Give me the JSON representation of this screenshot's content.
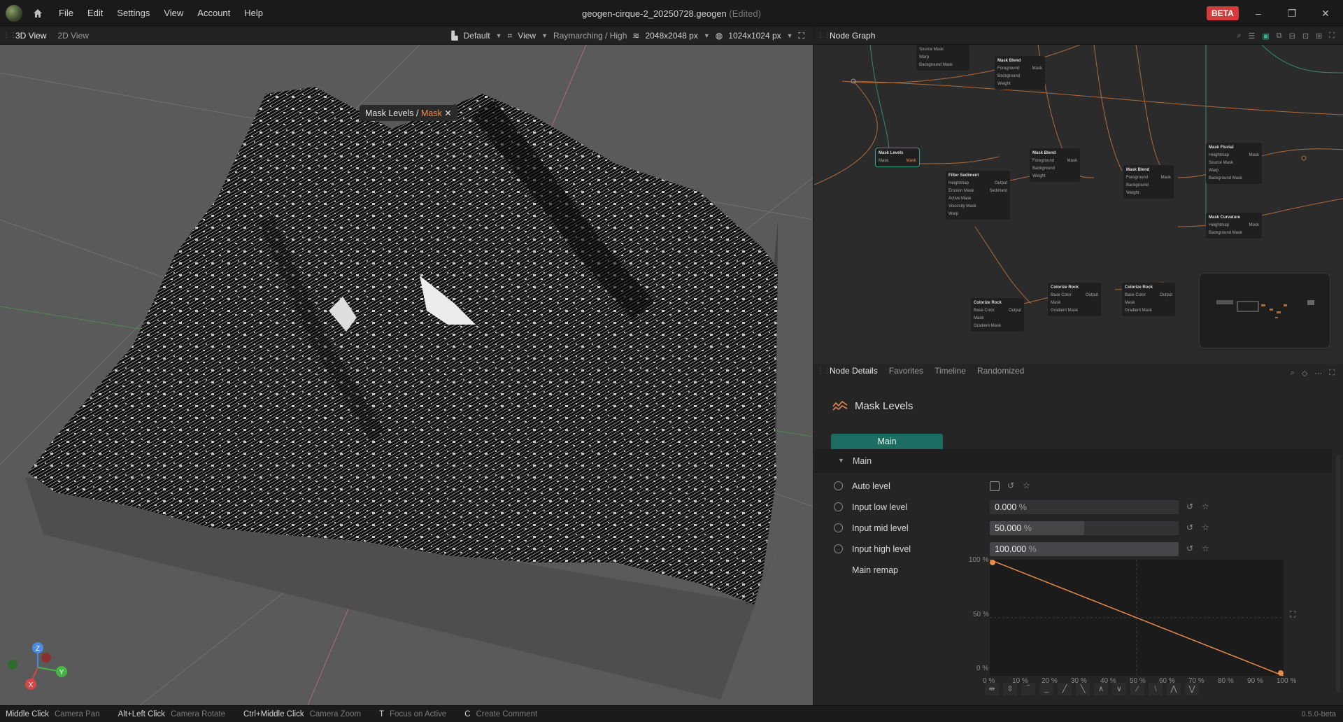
{
  "window": {
    "title": "geogen-cirque-2_20250728.geogen",
    "edited": "(Edited)",
    "badge": "BETA"
  },
  "menu": [
    "File",
    "Edit",
    "Settings",
    "View",
    "Account",
    "Help"
  ],
  "viewport_toolbar": {
    "tabs": [
      "3D View",
      "2D View"
    ],
    "preset": "Default",
    "view": "View",
    "render_mode": "Raymarching / High",
    "resolution": "2048x2048 px",
    "preview_resolution": "1024x1024 px"
  },
  "viewport": {
    "breadcrumb_node": "Mask Levels",
    "breadcrumb_sep": "/",
    "breadcrumb_port": "Mask",
    "gizmo": {
      "x": "X",
      "y": "Y",
      "z": "Z"
    }
  },
  "node_graph": {
    "title": "Node Graph",
    "nodes": [
      {
        "title": "",
        "ports": [
          "Source Mask",
          "Warp",
          "Background Mask"
        ]
      },
      {
        "title": "Mask Blend",
        "ports": [
          "Foreground",
          "Background",
          "Weight"
        ],
        "out": "Mask"
      },
      {
        "title": "Mask Levels",
        "ports": [
          "Mask"
        ],
        "out": "Mask"
      },
      {
        "title": "Filter Sediment",
        "ports": [
          "Heightmap",
          "Erosion Mask",
          "Active Mask",
          "Viscosity Mask",
          "Warp"
        ],
        "out": "Output",
        "out2": "Sediment"
      },
      {
        "title": "Mask Blend",
        "ports": [
          "Foreground",
          "Background",
          "Weight"
        ],
        "out": "Mask"
      },
      {
        "title": "Mask Blend",
        "ports": [
          "Foreground",
          "Background",
          "Weight"
        ],
        "out": "Mask"
      },
      {
        "title": "Mask Fluvial",
        "ports": [
          "Heightmap",
          "Source Mask",
          "Warp",
          "Background Mask"
        ],
        "out": "Mask"
      },
      {
        "title": "Mask Curvature",
        "ports": [
          "Heightmap",
          "Background Mask"
        ],
        "out": "Mask"
      },
      {
        "title": "Colorize Rock",
        "ports": [
          "Base Color",
          "Mask",
          "Gradient Mask"
        ],
        "out": "Output"
      },
      {
        "title": "Colorize Rock",
        "ports": [
          "Base Color",
          "Mask",
          "Gradient Mask"
        ],
        "out": "Output"
      },
      {
        "title": "Colorize Rock",
        "ports": [
          "Base Color",
          "Mask",
          "Gradient Mask"
        ],
        "out": "Output"
      }
    ]
  },
  "details": {
    "tabs": [
      "Node Details",
      "Favorites",
      "Timeline",
      "Randomized"
    ],
    "node_title": "Mask Levels",
    "section_tab": "Main",
    "section": "Main",
    "params": {
      "auto_level": {
        "label": "Auto level",
        "checked": false
      },
      "input_low": {
        "label": "Input low level",
        "value": "0.000",
        "unit": "%",
        "fraction": 0.0
      },
      "input_mid": {
        "label": "Input mid level",
        "value": "50.000",
        "unit": "%",
        "fraction": 0.5
      },
      "input_high": {
        "label": "Input high level",
        "value": "100.000",
        "unit": "%",
        "fraction": 1.0
      }
    },
    "remap": {
      "label": "Main remap",
      "y_ticks": [
        "100 %",
        "50 %",
        "0 %"
      ],
      "x_ticks": [
        "0 %",
        "10 %",
        "20 %",
        "30 %",
        "40 %",
        "50 %",
        "60 %",
        "70 %",
        "80 %",
        "90 %",
        "100 %"
      ],
      "points": [
        [
          0,
          100
        ],
        [
          100,
          0
        ]
      ]
    }
  },
  "status": [
    {
      "key": "Middle Click",
      "value": "Camera Pan"
    },
    {
      "key": "Alt+Left Click",
      "value": "Camera Rotate"
    },
    {
      "key": "Ctrl+Middle Click",
      "value": "Camera Zoom"
    },
    {
      "key": "T",
      "value": "Focus on Active"
    },
    {
      "key": "C",
      "value": "Create Comment"
    }
  ],
  "version": "0.5.0-beta",
  "colors": {
    "accent": "#1d6e62",
    "highlight": "#f08a4b",
    "beta": "#d63a3a"
  }
}
